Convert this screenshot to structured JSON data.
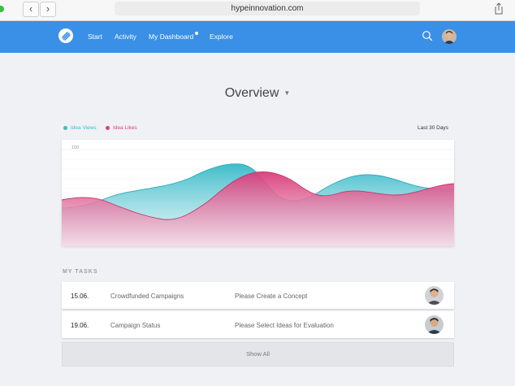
{
  "browser": {
    "url": "hypeinnovation.com"
  },
  "nav": {
    "items": [
      {
        "label": "Start"
      },
      {
        "label": "Activity"
      },
      {
        "label": "My Dashboard"
      },
      {
        "label": "Explore"
      }
    ]
  },
  "overview": {
    "title": "Overview",
    "range_label": "Last 30 Days"
  },
  "chart_data": {
    "type": "area",
    "y_tick_labels": [
      "100"
    ],
    "series": [
      {
        "name": "Idea Views",
        "color": "#3bbdc9"
      },
      {
        "name": "Idea Likes",
        "color": "#db3f7d"
      }
    ]
  },
  "tasks": {
    "title": "MY TASKS",
    "rows": [
      {
        "date": "15.06.",
        "name": "Crowdfunded Campaigns",
        "desc": "Please Create a Concept"
      },
      {
        "date": "19.06.",
        "name": "Campaign Status",
        "desc": "Please Select Ideas for Evaluation"
      }
    ],
    "show_all": "Show All"
  }
}
